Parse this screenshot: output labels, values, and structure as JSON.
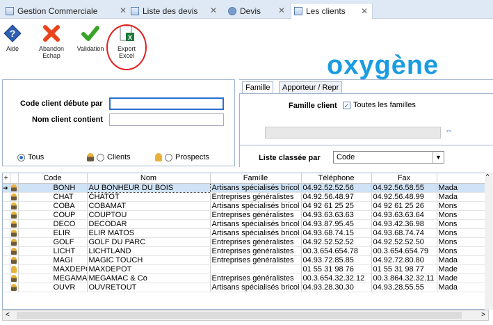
{
  "tabs": [
    {
      "label": "Gestion Commerciale",
      "active": false
    },
    {
      "label": "Liste des devis",
      "active": false
    },
    {
      "label": "Devis",
      "active": false
    },
    {
      "label": "Les clients",
      "active": true
    }
  ],
  "toolbar": {
    "aide": "Aide",
    "abandon": "Abandon",
    "abandon2": "Echap",
    "validation": "Validation",
    "export": "Export",
    "export2": "Excel"
  },
  "logo": "oxygène",
  "filters": {
    "code_label": "Code client débute par",
    "code_value": "",
    "nom_label": "Nom client contient",
    "nom_value": "",
    "radios": [
      "Tous",
      "Clients",
      "Prospects"
    ],
    "selected": "Tous"
  },
  "famille_panel": {
    "tab1": "Famille",
    "tab2": "Apporteur / Repr",
    "famille_label": "Famille client",
    "toutes_label": "Toutes les familles",
    "toutes_checked": true
  },
  "liste": {
    "label": "Liste classée par",
    "value": "Code"
  },
  "grid": {
    "columns": [
      "Code",
      "Nom",
      "Famille",
      "Téléphone",
      "Fax"
    ],
    "rows": [
      {
        "code": "BONH",
        "nom": "AU BONHEUR DU BOIS",
        "famille": "Artisans spécialisés bricol",
        "tel": "04.92.52.52.56",
        "fax": "04.92.56.58.55",
        "extra": "Mada",
        "selected": true
      },
      {
        "code": "CHAT",
        "nom": "CHATOT",
        "famille": "Entreprises généralistes",
        "tel": "04.92.56.48.97",
        "fax": "04.92.56.48.99",
        "extra": "Mada"
      },
      {
        "code": "COBA",
        "nom": "COBAMAT",
        "famille": "Artisans spécialisés bricol",
        "tel": "04 92 61 25 25",
        "fax": "04 92 61 25 26",
        "extra": "Mons"
      },
      {
        "code": "COUP",
        "nom": "COUPTOU",
        "famille": "Entreprises généralistes",
        "tel": "04.93.63.63.63",
        "fax": "04.93.63.63.64",
        "extra": "Mons"
      },
      {
        "code": "DECO",
        "nom": "DECODAR",
        "famille": "Artisans spécialisés bricol",
        "tel": "04.93.87.95.45",
        "fax": "04.93.42.36.98",
        "extra": "Mons"
      },
      {
        "code": "ELIR",
        "nom": "ELIR MATOS",
        "famille": "Artisans spécialisés bricol",
        "tel": "04.93.68.74.15",
        "fax": "04.93.68.74.74",
        "extra": "Mons"
      },
      {
        "code": "GOLF",
        "nom": "GOLF DU PARC",
        "famille": "Entreprises généralistes",
        "tel": "04.92.52.52.52",
        "fax": "04.92.52.52.50",
        "extra": "Mons"
      },
      {
        "code": "LICHT",
        "nom": "LICHTLAND",
        "famille": "Entreprises généralistes",
        "tel": "00.3.654.654.78",
        "fax": "00.3.654.654.79",
        "extra": "Mons"
      },
      {
        "code": "MAGI",
        "nom": "MAGIC TOUCH",
        "famille": "Entreprises généralistes",
        "tel": "04.93.72.85.85",
        "fax": "04.92.72.80.80",
        "extra": "Mada"
      },
      {
        "code": "MAXDEPOT",
        "nom": "MAXDEPOT",
        "famille": "",
        "tel": "01 55 31 98 76",
        "fax": "01 55 31 98 77",
        "extra": "Made"
      },
      {
        "code": "MEGAMAC",
        "nom": "MEGAMAC & Co",
        "famille": "Entreprises généralistes",
        "tel": "00.3.654.32.32.12",
        "fax": "00.3.864.32.32.11",
        "extra": "Made"
      },
      {
        "code": "OUVR",
        "nom": "OUVRETOUT",
        "famille": "Artisans spécialisés bricol",
        "tel": "04.93.28.30.30",
        "fax": "04.93.28.55.55",
        "extra": "Mada"
      }
    ]
  }
}
